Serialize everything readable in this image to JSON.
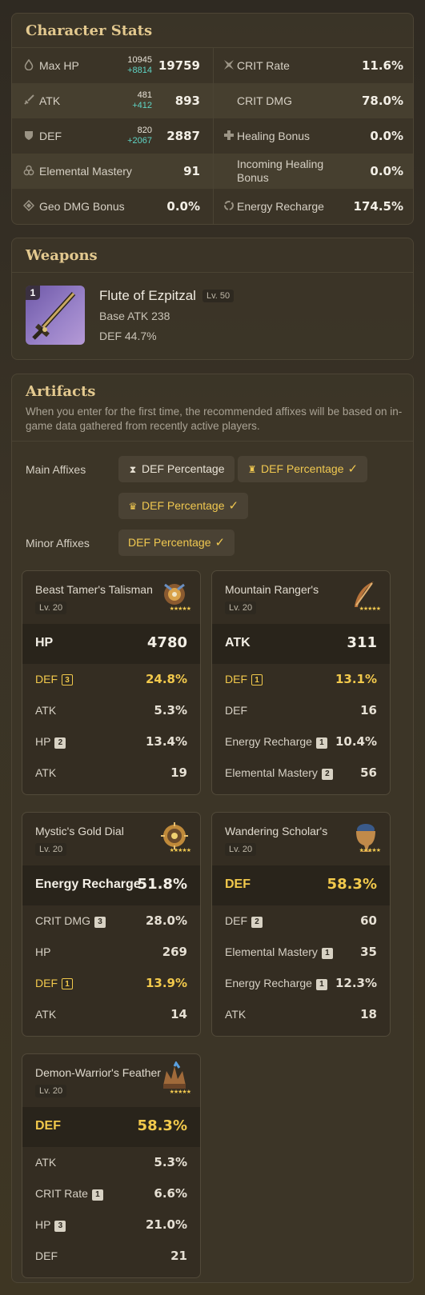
{
  "stats": {
    "title": "Character Stats",
    "rows": [
      {
        "left": {
          "label": "Max HP",
          "icon": "drop-icon",
          "base": "10945",
          "bonus": "+8814",
          "value": "19759"
        },
        "right": {
          "label": "CRIT Rate",
          "icon": "crit-icon",
          "value": "11.6%"
        }
      },
      {
        "left": {
          "label": "ATK",
          "icon": "sword-icon",
          "base": "481",
          "bonus": "+412",
          "value": "893"
        },
        "right": {
          "label": "CRIT DMG",
          "icon": "",
          "value": "78.0%"
        }
      },
      {
        "left": {
          "label": "DEF",
          "icon": "shield-icon",
          "base": "820",
          "bonus": "+2067",
          "value": "2887"
        },
        "right": {
          "label": "Healing Bonus",
          "icon": "cross-icon",
          "value": "0.0%"
        }
      },
      {
        "left": {
          "label": "Elemental Mastery",
          "icon": "mastery-icon",
          "value": "91"
        },
        "right": {
          "label": "Incoming Healing Bonus",
          "icon": "",
          "value": "0.0%"
        }
      },
      {
        "left": {
          "label": "Geo DMG Bonus",
          "icon": "geo-icon",
          "value": "0.0%"
        },
        "right": {
          "label": "Energy Recharge",
          "icon": "recharge-icon",
          "value": "174.5%"
        }
      }
    ]
  },
  "weapons": {
    "title": "Weapons",
    "refinement": "1",
    "name": "Flute of Ezpitzal",
    "level": "Lv. 50",
    "base_atk": "Base ATK 238",
    "substat": "DEF 44.7%"
  },
  "artifacts": {
    "title": "Artifacts",
    "description": "When you enter for the first time, the recommended affixes will be based on in-game data gathered from recently active players.",
    "main_affixes_label": "Main Affixes",
    "minor_affixes_label": "Minor Affixes",
    "main_affixes": [
      {
        "label": "DEF Percentage",
        "icon": "hourglass-icon",
        "selected": false
      },
      {
        "label": "DEF Percentage",
        "icon": "goblet-icon",
        "selected": true
      },
      {
        "label": "DEF Percentage",
        "icon": "crown-icon",
        "selected": true
      }
    ],
    "minor_affixes": [
      {
        "label": "DEF Percentage",
        "selected": true
      }
    ],
    "check": "✓",
    "stars": "★★★★★",
    "cards": [
      {
        "name": "Beast Tamer's Talisman",
        "level": "Lv. 20",
        "main": {
          "name": "HP",
          "value": "4780",
          "gold": false
        },
        "subs": [
          {
            "name": "DEF",
            "roll": "3",
            "value": "24.8%",
            "gold": true
          },
          {
            "name": "ATK",
            "roll": "",
            "value": "5.3%",
            "gold": false
          },
          {
            "name": "HP",
            "roll": "2",
            "value": "13.4%",
            "gold": false
          },
          {
            "name": "ATK",
            "roll": "",
            "value": "19",
            "gold": false
          }
        ]
      },
      {
        "name": "Mountain Ranger's",
        "level": "Lv. 20",
        "main": {
          "name": "ATK",
          "value": "311",
          "gold": false
        },
        "subs": [
          {
            "name": "DEF",
            "roll": "1",
            "value": "13.1%",
            "gold": true
          },
          {
            "name": "DEF",
            "roll": "",
            "value": "16",
            "gold": false
          },
          {
            "name": "Energy Recharge",
            "roll": "1",
            "value": "10.4%",
            "gold": false
          },
          {
            "name": "Elemental Mastery",
            "roll": "2",
            "value": "56",
            "gold": false
          }
        ]
      },
      {
        "name": "Mystic's Gold Dial",
        "level": "Lv. 20",
        "main": {
          "name": "Energy Recharge",
          "value": "51.8%",
          "gold": false
        },
        "subs": [
          {
            "name": "CRIT DMG",
            "roll": "3",
            "value": "28.0%",
            "gold": false
          },
          {
            "name": "HP",
            "roll": "",
            "value": "269",
            "gold": false
          },
          {
            "name": "DEF",
            "roll": "1",
            "value": "13.9%",
            "gold": true
          },
          {
            "name": "ATK",
            "roll": "",
            "value": "14",
            "gold": false
          }
        ]
      },
      {
        "name": "Wandering Scholar's",
        "level": "Lv. 20",
        "main": {
          "name": "DEF",
          "value": "58.3%",
          "gold": true
        },
        "subs": [
          {
            "name": "DEF",
            "roll": "2",
            "value": "60",
            "gold": false
          },
          {
            "name": "Elemental Mastery",
            "roll": "1",
            "value": "35",
            "gold": false
          },
          {
            "name": "Energy Recharge",
            "roll": "1",
            "value": "12.3%",
            "gold": false
          },
          {
            "name": "ATK",
            "roll": "",
            "value": "18",
            "gold": false
          }
        ]
      },
      {
        "name": "Demon-Warrior's Feather",
        "level": "Lv. 20",
        "main": {
          "name": "DEF",
          "value": "58.3%",
          "gold": true
        },
        "subs": [
          {
            "name": "ATK",
            "roll": "",
            "value": "5.3%",
            "gold": false
          },
          {
            "name": "CRIT Rate",
            "roll": "1",
            "value": "6.6%",
            "gold": false
          },
          {
            "name": "HP",
            "roll": "3",
            "value": "21.0%",
            "gold": false
          },
          {
            "name": "DEF",
            "roll": "",
            "value": "21",
            "gold": false
          }
        ]
      }
    ]
  }
}
